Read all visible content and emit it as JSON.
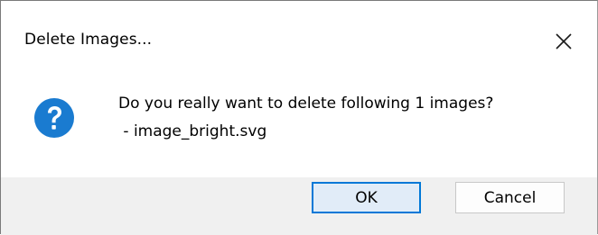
{
  "dialog": {
    "title": "Delete Images...",
    "icon": "question-icon",
    "message": "Do you really want to delete following 1 images?",
    "items": [
      " - image_bright.svg"
    ],
    "buttons": {
      "ok_label": "OK",
      "cancel_label": "Cancel"
    },
    "colors": {
      "icon_blue": "#1a7bd0",
      "focus_border": "#0078d7",
      "ok_background": "#e1ecf8",
      "button_bar": "#f0f0f0"
    }
  }
}
